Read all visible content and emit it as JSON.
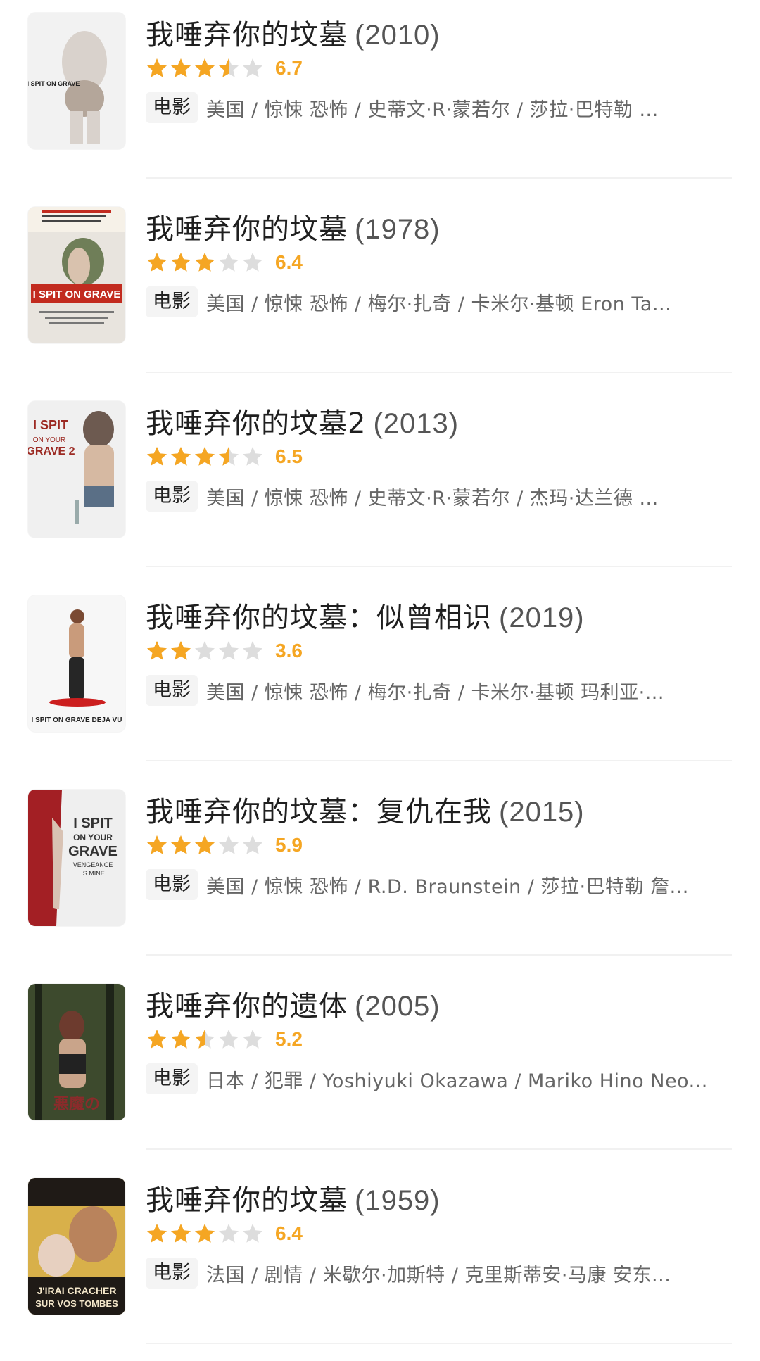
{
  "movies": [
    {
      "title": "我唾弃你的坟墓",
      "year": "(2010)",
      "score": "6.7",
      "stars": 3.5,
      "type": "电影",
      "meta": "美国 / 惊悚 恐怖 / 史蒂文·R·蒙若尔 / 莎拉·巴特勒 ...",
      "poster_icon": "poster-woman-back",
      "poster_colors": [
        "#f2f2f2",
        "#d9d2cc",
        "#b4a69a"
      ]
    },
    {
      "title": "我唾弃你的坟墓",
      "year": "(1978)",
      "score": "6.4",
      "stars": 3,
      "type": "电影",
      "meta": "美国 / 惊悚 恐怖 / 梅尔·扎奇 / 卡米尔·基顿 Eron Ta...",
      "poster_icon": "poster-1978-red-title",
      "poster_colors": [
        "#e8e4de",
        "#c22b1f",
        "#2d2d2d"
      ]
    },
    {
      "title": "我唾弃你的坟墓2",
      "year": "(2013)",
      "score": "6.5",
      "stars": 3.5,
      "type": "电影",
      "meta": "美国 / 惊悚 恐怖 / 史蒂文·R·蒙若尔 / 杰玛·达兰德 ...",
      "poster_icon": "poster-woman-knife",
      "poster_colors": [
        "#f0f0f0",
        "#9c2a23",
        "#6d5a50"
      ]
    },
    {
      "title": "我唾弃你的坟墓：似曾相识",
      "year": "(2019)",
      "score": "3.6",
      "stars": 2,
      "type": "电影",
      "meta": "美国 / 惊悚 恐怖 / 梅尔·扎奇 / 卡米尔·基顿 玛利亚·...",
      "poster_icon": "poster-woman-standing",
      "poster_colors": [
        "#f7f7f7",
        "#cc1f1f",
        "#262626"
      ]
    },
    {
      "title": "我唾弃你的坟墓：复仇在我",
      "year": "(2015)",
      "score": "5.9",
      "stars": 3,
      "type": "电影",
      "meta": "美国 / 惊悚 恐怖 / R.D. Braunstein / 莎拉·巴特勒 詹...",
      "poster_icon": "poster-vengeance",
      "poster_colors": [
        "#efefef",
        "#a31f24",
        "#333333"
      ]
    },
    {
      "title": "我唾弃你的遗体",
      "year": "(2005)",
      "score": "5.2",
      "stars": 2.5,
      "type": "电影",
      "meta": "日本 / 犯罪 / Yoshiyuki Okazawa / Mariko Hino Neo...",
      "poster_icon": "poster-forest",
      "poster_colors": [
        "#3d4a2d",
        "#8b2b2b",
        "#1e2418"
      ]
    },
    {
      "title": "我唾弃你的坟墓",
      "year": "(1959)",
      "score": "6.4",
      "stars": 3,
      "type": "电影",
      "meta": "法国 / 剧情 / 米歇尔·加斯特 / 克里斯蒂安·马康 安东...",
      "poster_icon": "poster-j-irai-cracher",
      "poster_colors": [
        "#d8b04a",
        "#1f1a16",
        "#c73a2a"
      ]
    }
  ],
  "colors": {
    "star_active": "#f5a623",
    "star_inactive": "#dddddd",
    "score": "#f5a623"
  }
}
